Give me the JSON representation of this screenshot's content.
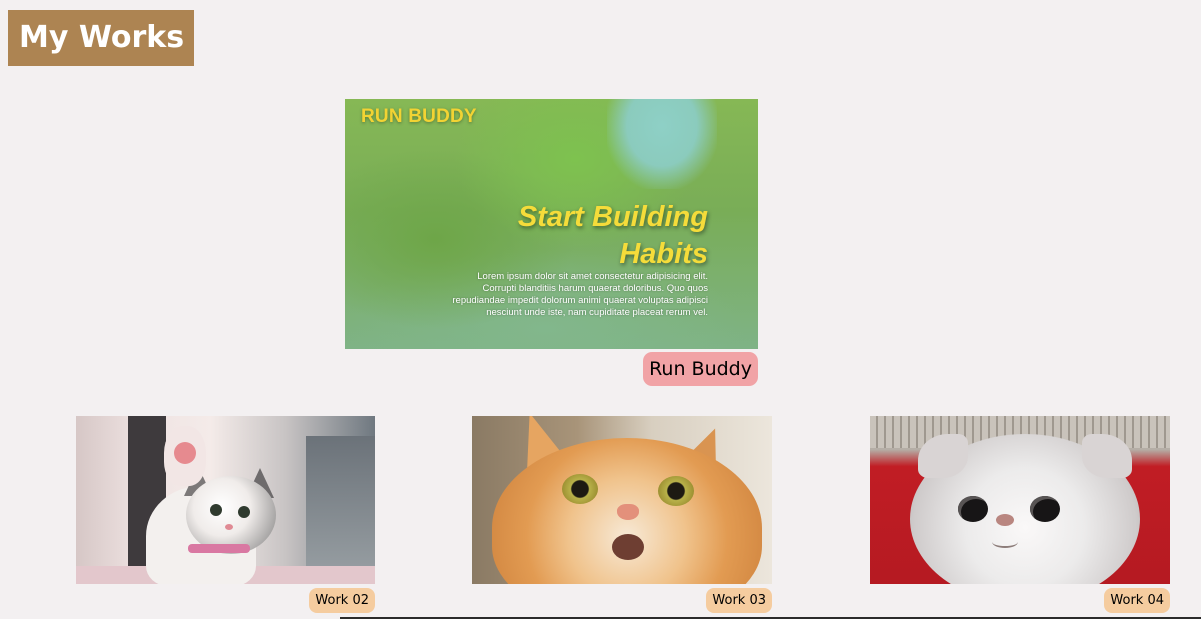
{
  "section": {
    "title": "My Works"
  },
  "featured": {
    "image_brand": "RUN BUDDY",
    "image_headline_line1": "Start Building",
    "image_headline_line2": "Habits",
    "image_body": "Lorem ipsum dolor sit amet consectetur adipisicing elit. Corrupti blanditiis harum quaerat doloribus. Quo quos repudiandae impedit dolorum animi quaerat voluptas adipisci nesciunt unde iste, nam cupiditate placeat rerum vel.",
    "label": "Run Buddy",
    "label_color": "#f1a3a6"
  },
  "works": [
    {
      "label": "Work 02",
      "image": "kitten-waving"
    },
    {
      "label": "Work 03",
      "image": "orange-cat-surprised"
    },
    {
      "label": "Work 04",
      "image": "white-persian-cat"
    }
  ],
  "colors": {
    "background": "#f3f0f1",
    "title_bg": "#ad8452",
    "work_label_bg": "#f5cc9f",
    "brand_yellow": "#f5dc3a"
  }
}
